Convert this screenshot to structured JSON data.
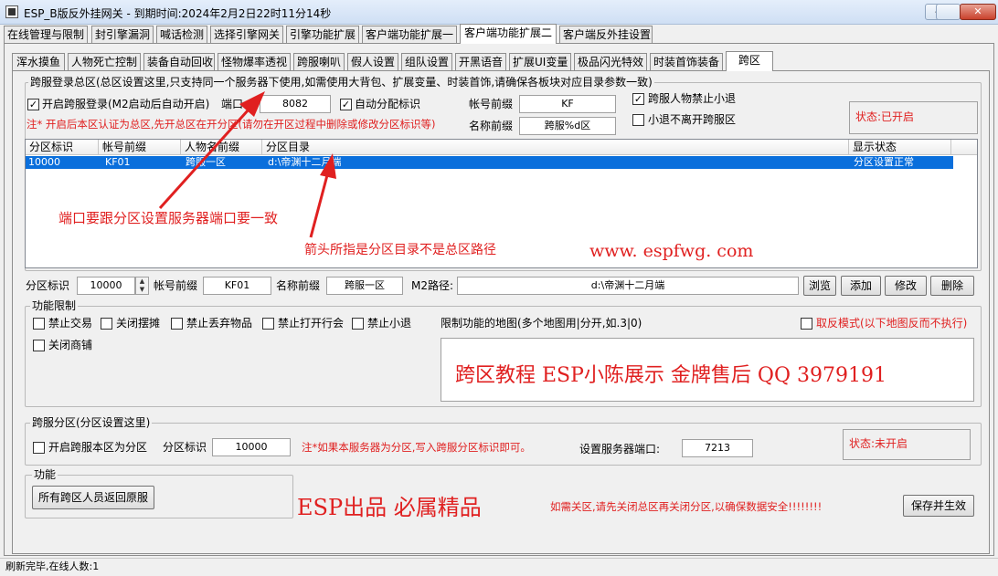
{
  "window": {
    "title": "ESP_B版反外挂网关 - 到期时间:2024年2月2日22时11分14秒",
    "min_label": "–",
    "max_label": "□",
    "close_label": "✕"
  },
  "main_tabs": [
    {
      "label": "在线管理与限制"
    },
    {
      "label": "封引擎漏洞"
    },
    {
      "label": "喊话检测"
    },
    {
      "label": "选择引擎网关"
    },
    {
      "label": "引擎功能扩展"
    },
    {
      "label": "客户端功能扩展一"
    },
    {
      "label": "客户端功能扩展二"
    },
    {
      "label": "客户端反外挂设置"
    }
  ],
  "sub_tabs": [
    {
      "label": "浑水摸鱼"
    },
    {
      "label": "人物死亡控制"
    },
    {
      "label": "装备自动回收"
    },
    {
      "label": "怪物爆率透视"
    },
    {
      "label": "跨服喇叭"
    },
    {
      "label": "假人设置"
    },
    {
      "label": "组队设置"
    },
    {
      "label": "开黑语音"
    },
    {
      "label": "扩展UI变量"
    },
    {
      "label": "极品闪光特效"
    },
    {
      "label": "时装首饰装备"
    },
    {
      "label": "跨区"
    }
  ],
  "master": {
    "group_title": "跨服登录总区(总区设置这里,只支持同一个服务器下使用,如需使用大背包、扩展变量、时装首饰,请确保各板块对应目录参数一致)",
    "enable_label": "开启跨服登录(M2启动后自动开启)",
    "port_label": "端口:",
    "port_value": "8082",
    "auto_label": "自动分配标识",
    "account_prefix_label": "帐号前缀",
    "account_prefix_value": "KF",
    "name_prefix_label": "名称前缀",
    "name_prefix_value": "跨服%d区",
    "ban_exit_label": "跨服人物禁止小退",
    "noleave_label": "小退不离开跨服区",
    "note": "注* 开启后本区认证为总区,先开总区在开分区(请勿在开区过程中删除或修改分区标识等)",
    "status": "状态:已开启"
  },
  "list": {
    "columns": [
      "分区标识",
      "帐号前缀",
      "人物名前缀",
      "分区目录",
      "显示状态"
    ],
    "rows": [
      {
        "id": "10000",
        "account": "KF01",
        "name": "跨服一区",
        "dir": "d:\\帝渊十二月端",
        "status": "分区设置正常"
      }
    ]
  },
  "annotations": {
    "port_note": "端口要跟分区设置服务器端口要一致",
    "dir_note": "箭头所指是分区目录不是总区路径",
    "website": "www. espfwg. com"
  },
  "edit": {
    "id_label": "分区标识",
    "id_value": "10000",
    "account_label": "帐号前缀",
    "account_value": "KF01",
    "name_label": "名称前缀",
    "name_value": "跨服一区",
    "path_label": "M2路径:",
    "path_value": "d:\\帝渊十二月端",
    "browse_label": "浏览",
    "add_label": "添加",
    "modify_label": "修改",
    "delete_label": "删除"
  },
  "limits": {
    "group_title": "功能限制",
    "trade": "禁止交易",
    "stall": "关闭摆摊",
    "drop": "禁止丢弃物品",
    "guild": "禁止打开行会",
    "quit": "禁止小退",
    "shop": "关闭商铺",
    "map_label": "限制功能的地图(多个地图用|分开,如.3|0)",
    "invert_label": "取反模式(以下地图反而不执行)",
    "banner": "跨区教程 ESP小陈展示 金牌售后 QQ 3979191"
  },
  "sub": {
    "group_title": "跨服分区(分区设置这里)",
    "enable_label": "开启跨服本区为分区",
    "id_label": "分区标识",
    "id_value": "10000",
    "note": "注*如果本服务器为分区,写入跨服分区标识即可。",
    "port_label": "设置服务器端口:",
    "port_value": "7213",
    "status": "状态:未开启"
  },
  "func": {
    "group_title": "功能",
    "return_label": "所有跨区人员返回原服"
  },
  "footer": {
    "slogan": "ESP出品 必属精品",
    "warning": "如需关区,请先关闭总区再关闭分区,以确保数据安全!!!!!!!!",
    "save_label": "保存并生效"
  },
  "statusbar": {
    "text": "刷新完毕,在线人数:1"
  },
  "colors": {
    "accent_red": "#e02020",
    "selection_blue": "#0a6fdc"
  }
}
